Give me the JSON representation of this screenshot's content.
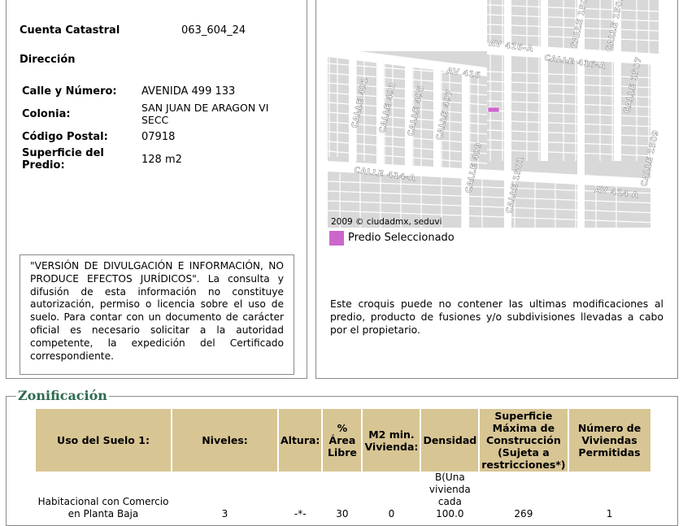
{
  "cuenta": {
    "label": "Cuenta Catastral",
    "value": "063_604_24"
  },
  "direccion_heading": "Dirección",
  "direccion": {
    "calle_label": "Calle y Número:",
    "calle_value": "AVENIDA 499 133",
    "colonia_label": "Colonia:",
    "colonia_value": "SAN JUAN DE ARAGON VI SECC",
    "cp_label": "Código Postal:",
    "cp_value": "07918",
    "superficie_label": "Superficie del Predio:",
    "superficie_value": "128 m2"
  },
  "disclaimer": "\"VERSIÓN DE DIVULGACIÓN E INFORMACIÓN, NO PRODUCE EFECTOS JURÍDICOS\". La consulta y difusión de esta información no constituye autorización, permiso o licencia sobre el uso de suelo. Para contar con un documento de carácter oficial es necesario solicitar a la autoridad competente, la expedición del Certificado correspondiente.",
  "map": {
    "credit": "2009 © ciudadmx, seduvi",
    "streets": [
      "AV 416-A",
      "CALLE 416-A",
      "AV 416",
      "CALLE 491",
      "CALLE 493",
      "CALLE 495",
      "CALLE 497",
      "CALLE 499",
      "CALLE 1501",
      "CALLE 1503",
      "CALLE 1505",
      "CALLE 1507",
      "CALLE 1509",
      "CALLE 414-A",
      "AV 414 A",
      "CALLE 414-A"
    ],
    "legend_label": "Predio Seleccionado",
    "legend_color": "#cc66cc"
  },
  "croquis_note": "Este croquis puede no contener las ultimas modificaciones al predio, producto de fusiones y/o subdivisiones llevadas a cabo por el propietario.",
  "zonificacion": {
    "title": "Zonificación",
    "headers": [
      "Uso del Suelo 1:",
      "Niveles:",
      "Altura:",
      "% Área Libre",
      "M2 min. Vivienda:",
      "Densidad",
      "Superficie Máxima de Construcción (Sujeta a restricciones*)",
      "Número de Viviendas Permitidas"
    ],
    "row": [
      "Habitacional con Comercio en Planta Baja",
      "3",
      "-*-",
      "30",
      "0",
      "B(Una vivienda cada 100.0",
      "269",
      "1"
    ]
  }
}
